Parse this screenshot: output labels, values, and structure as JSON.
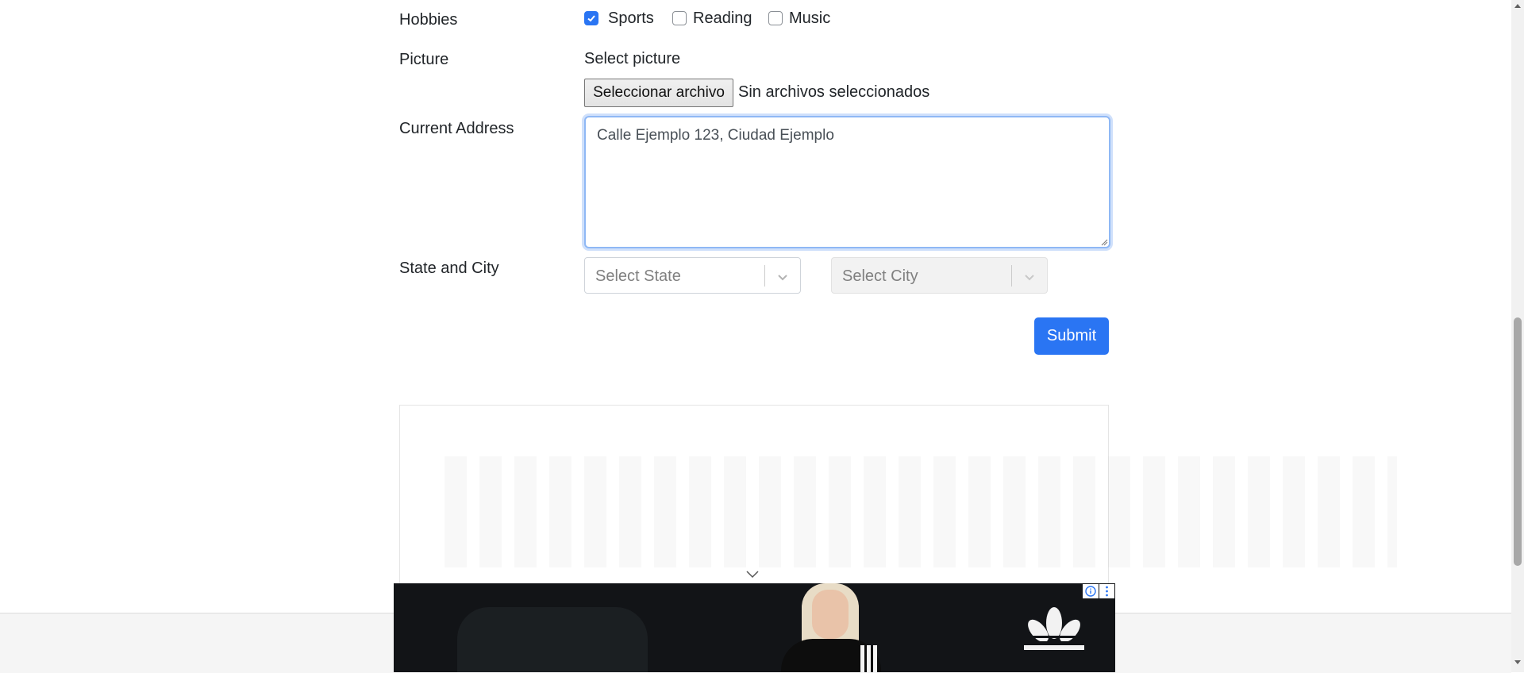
{
  "form": {
    "hobbies": {
      "label": "Hobbies",
      "options": [
        {
          "label": "Sports",
          "checked": true
        },
        {
          "label": "Reading",
          "checked": false
        },
        {
          "label": "Music",
          "checked": false
        }
      ]
    },
    "picture": {
      "label": "Picture",
      "select_label": "Select picture",
      "button_label": "Seleccionar archivo",
      "status": "Sin archivos seleccionados"
    },
    "address": {
      "label": "Current Address",
      "value": "Calle Ejemplo 123, Ciudad Ejemplo"
    },
    "state_city": {
      "label": "State and City",
      "state_placeholder": "Select State",
      "city_placeholder": "Select City"
    },
    "submit_label": "Submit"
  },
  "ad": {
    "brand_icon": "adidas-trefoil-logo",
    "info_icon": "ad-info-icon",
    "menu_icon": "ad-menu-icon"
  },
  "colors": {
    "primary": "#2a75f3",
    "focus_border": "#8fb8f5"
  }
}
